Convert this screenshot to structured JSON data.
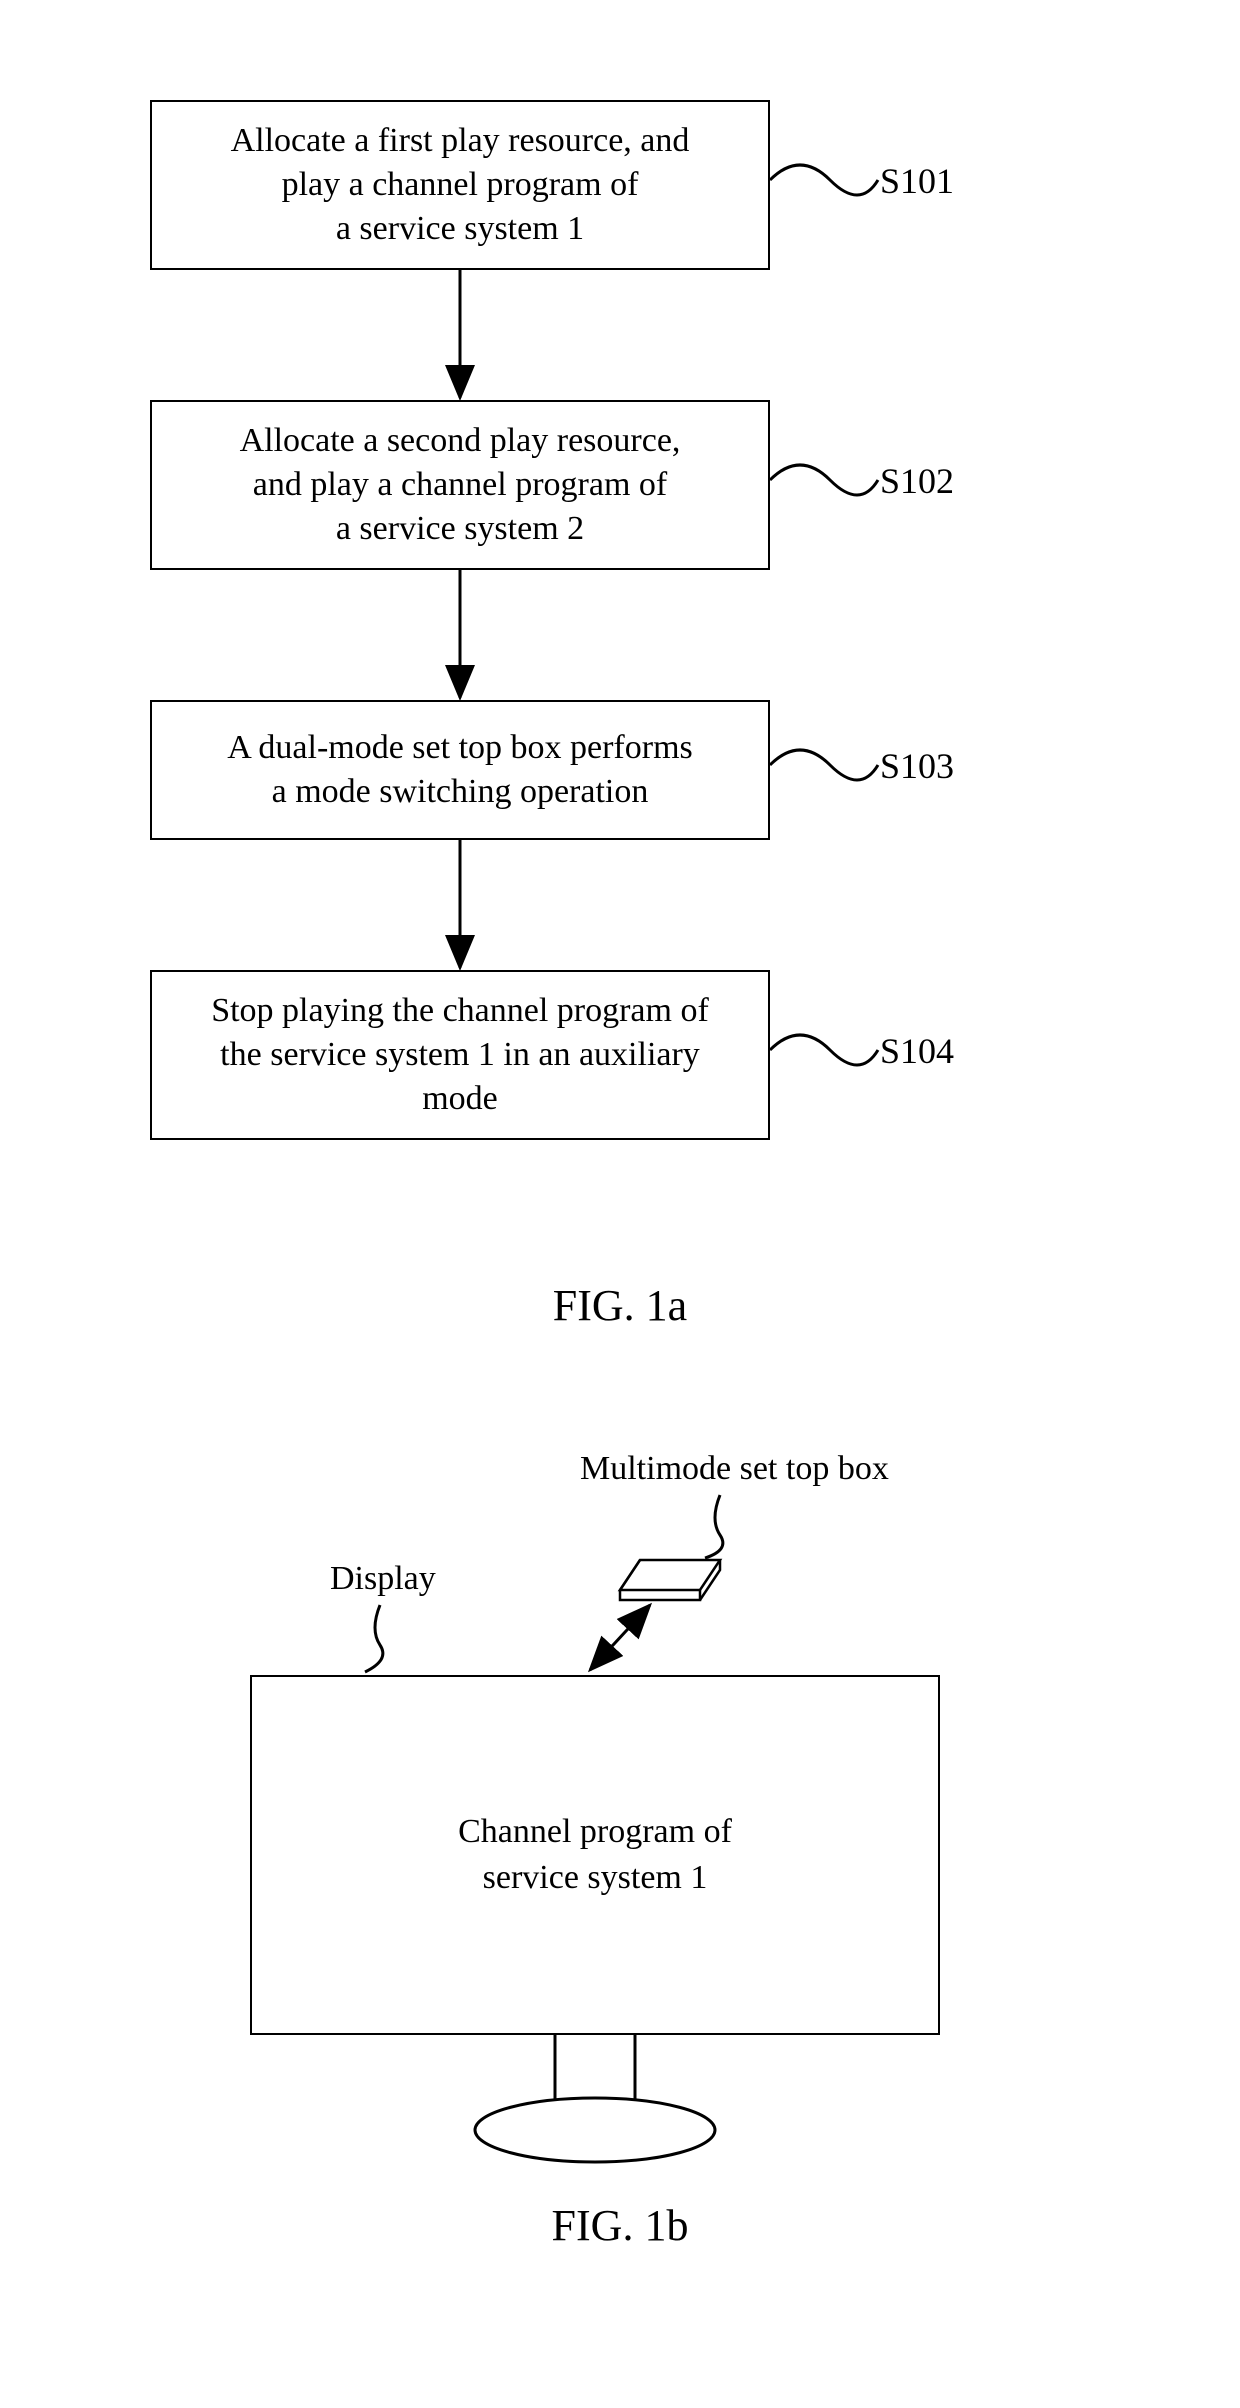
{
  "figure1a": {
    "steps": [
      {
        "id": "S101",
        "text": "Allocate a first play resource, and\nplay a channel program of\na service system 1"
      },
      {
        "id": "S102",
        "text": "Allocate a second play resource,\nand play a channel program of\na service system 2"
      },
      {
        "id": "S103",
        "text": "A dual-mode set top box performs\na mode switching operation"
      },
      {
        "id": "S104",
        "text": "Stop playing the channel program of\nthe service system 1 in an auxiliary\nmode"
      }
    ],
    "caption": "FIG. 1a"
  },
  "figure1b": {
    "displayLabel": "Display",
    "stbLabel": "Multimode set top box",
    "screenText": "Channel program of\nservice system 1",
    "caption": "FIG. 1b"
  }
}
